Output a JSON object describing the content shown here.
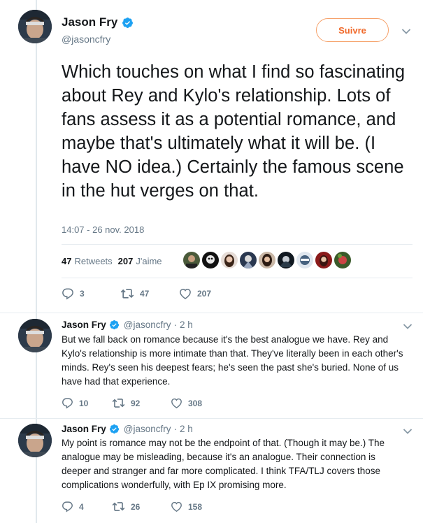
{
  "main_tweet": {
    "author_name": "Jason Fry",
    "author_handle": "@jasoncfry",
    "follow_label": "Suivre",
    "text": "Which touches on what I find so fascinating about Rey and Kylo's relationship. Lots of fans assess it as a potential romance, and maybe that's ultimately what it will be. (I have NO idea.) Certainly the famous scene in the hut verges on that.",
    "timestamp": "14:07 - 26 nov. 2018",
    "retweets_count": "47",
    "retweets_label": "Retweets",
    "likes_count": "207",
    "likes_label": "J'aime",
    "replies": "3",
    "retweets": "47",
    "likes": "207"
  },
  "replies": [
    {
      "author_name": "Jason Fry",
      "author_handle": "@jasoncfry",
      "age": "2 h",
      "text": "But we fall back on romance because it's the best analogue we have. Rey and Kylo's relationship is more intimate than that. They've literally been in each other's minds. Rey's seen his deepest fears; he's seen the past she's buried. None of us have had that experience.",
      "replies": "10",
      "retweets": "92",
      "likes": "308"
    },
    {
      "author_name": "Jason Fry",
      "author_handle": "@jasoncfry",
      "age": "2 h",
      "text": "My point is romance may not be the endpoint of that. (Though it may be.) The analogue may be misleading, because it's an analogue. Their connection is deeper and stranger and far more complicated. I think TFA/TLJ covers those complications wonderfully, with Ep IX promising more.",
      "replies": "4",
      "retweets": "26",
      "likes": "158"
    }
  ],
  "colors": {
    "text": "#14171a",
    "secondary": "#657786",
    "verified": "#1da1f2",
    "follow_accent": "#f0692a",
    "divider": "#e6ecf0"
  },
  "icons": [
    "verified-badge-icon",
    "chevron-down-icon",
    "reply-icon",
    "retweet-icon",
    "like-icon"
  ]
}
